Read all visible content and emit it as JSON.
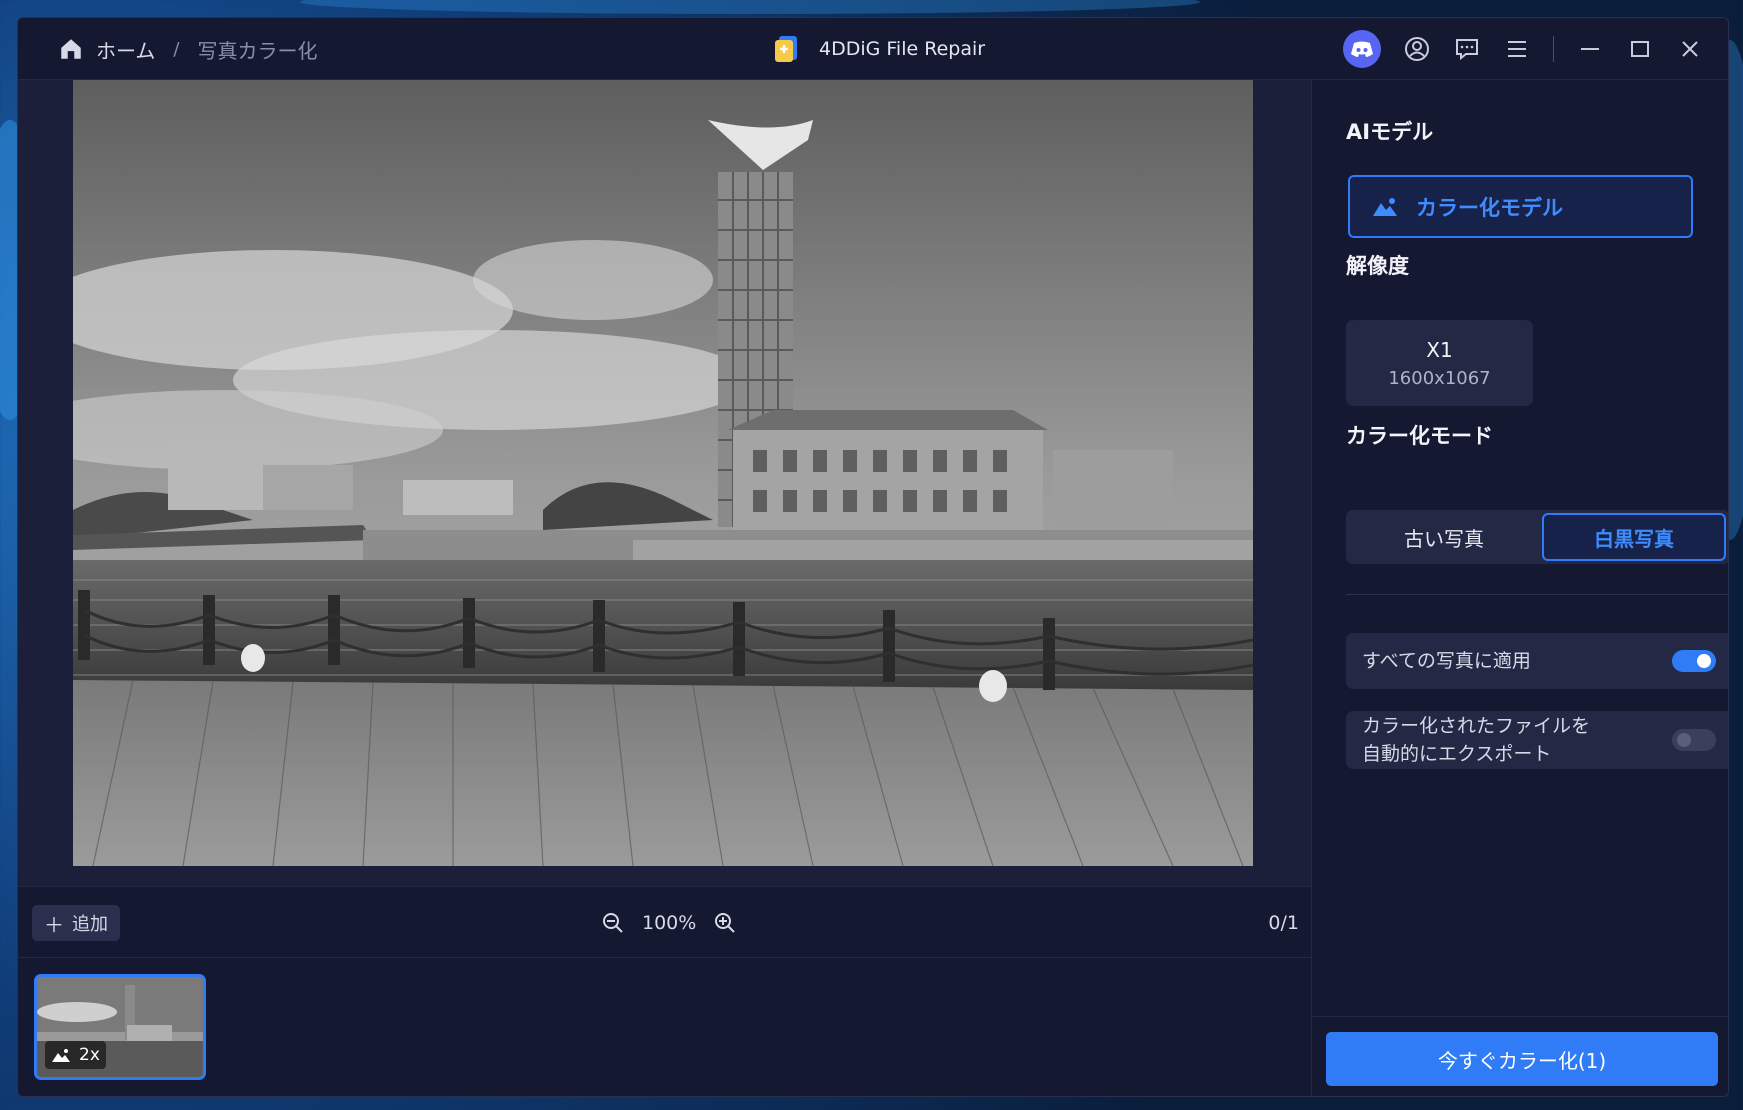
{
  "breadcrumb": {
    "home": "ホーム",
    "separator": "/",
    "current": "写真カラー化"
  },
  "app": {
    "title": "4DDiG File Repair"
  },
  "titlebar_icons": [
    "discord-icon",
    "account-icon",
    "feedback-icon",
    "menu-icon",
    "minimize-icon",
    "maximize-icon",
    "close-icon"
  ],
  "toolbar": {
    "add_label": "追加",
    "zoom": "100%",
    "counter": "0/1"
  },
  "thumbnail": {
    "badge": "2x"
  },
  "panel": {
    "ai_model_title": "AIモデル",
    "model_label": "カラー化モデル",
    "resolution_title": "解像度",
    "resolution_scale": "X1",
    "resolution_size": "1600x1067",
    "mode_title": "カラー化モード",
    "mode_old": "古い写真",
    "mode_bw": "白黒写真",
    "apply_all": "すべての写真に適用",
    "apply_all_enabled": true,
    "auto_export_line1": "カラー化されたファイルを",
    "auto_export_line2": "自動的にエクスポート",
    "auto_export_enabled": false,
    "cta": "今すぐカラー化(1)"
  },
  "colors": {
    "accent": "#2f7cf6",
    "window_bg": "#151831",
    "panel_item_bg": "#232844"
  }
}
